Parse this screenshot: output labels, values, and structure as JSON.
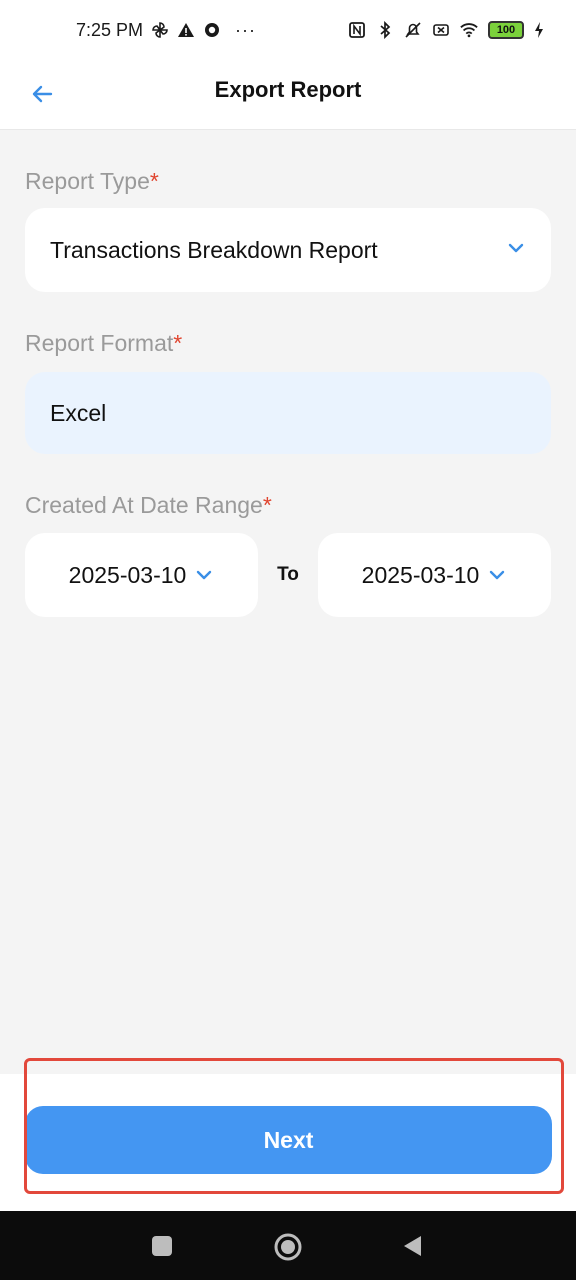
{
  "status_bar": {
    "time": "7:25 PM",
    "dots": "···",
    "battery": "100"
  },
  "header": {
    "title": "Export Report"
  },
  "form": {
    "report_type": {
      "label": "Report Type",
      "required_mark": "*",
      "value": "Transactions Breakdown Report"
    },
    "report_format": {
      "label": "Report Format",
      "required_mark": "*",
      "value": "Excel"
    },
    "date_range": {
      "label": "Created At Date Range",
      "required_mark": "*",
      "from": "2025-03-10",
      "separator": "To",
      "to": "2025-03-10"
    }
  },
  "footer": {
    "next_label": "Next"
  },
  "colors": {
    "accent": "#4496f2",
    "required": "#e0452f",
    "highlight": "#e2483b",
    "format_bg": "#eaf3fe"
  },
  "icons": [
    "back-arrow-icon",
    "chevron-down-icon",
    "nav-recents-icon",
    "nav-home-icon",
    "nav-back-icon"
  ]
}
